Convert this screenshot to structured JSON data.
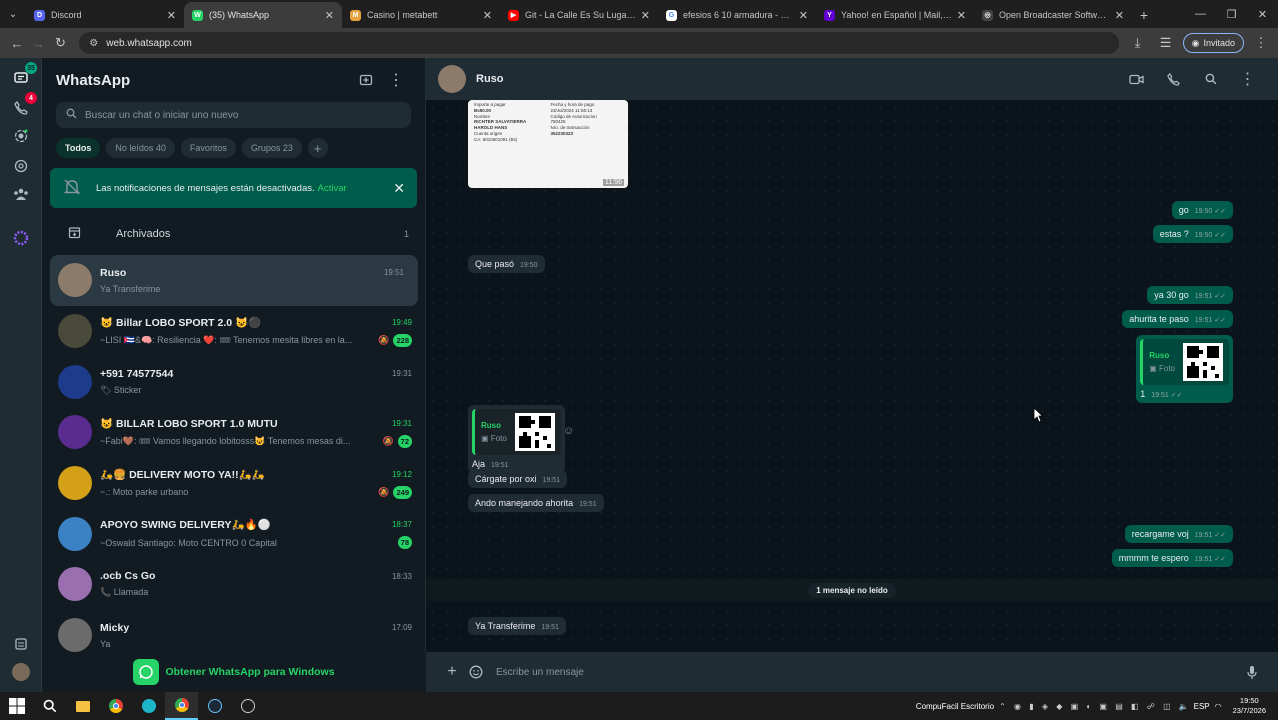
{
  "browser": {
    "tabs": [
      {
        "title": "Discord",
        "color": "#5865f2",
        "glyph": "D"
      },
      {
        "title": "(35) WhatsApp",
        "color": "#25d366",
        "glyph": "W",
        "active": true
      },
      {
        "title": "Casino | metabett",
        "color": "#e8a33d",
        "glyph": "M"
      },
      {
        "title": "Git - La Calle Es Su Lugar (A",
        "color": "#ff0000",
        "glyph": "▶"
      },
      {
        "title": "efesios 6 10 armadura - Buscar",
        "color": "#ffffff",
        "glyph": "G"
      },
      {
        "title": "Yahoo! en Español | Mail, Clima",
        "color": "#6001d2",
        "glyph": "Y"
      },
      {
        "title": "Open Broadcaster Software | O",
        "color": "#444444",
        "glyph": "◎"
      }
    ],
    "url": "web.whatsapp.com",
    "profile_label": "Invitado"
  },
  "rail": {
    "chats_badge": "35",
    "calls_badge": "4"
  },
  "sidebar": {
    "title": "WhatsApp",
    "search_placeholder": "Buscar un chat o iniciar uno nuevo",
    "filters": [
      "Todos",
      "No leídos 40",
      "Favoritos",
      "Grupos 23"
    ],
    "notification_text": "Las notificaciones de mensajes están desactivadas.",
    "notification_action": "Activar",
    "archived_label": "Archivados",
    "archived_count": "1",
    "get_windows": "Obtener WhatsApp para Windows"
  },
  "chats": [
    {
      "name": "Ruso",
      "message": "Ya Transferime",
      "time": "19:51",
      "unread": "",
      "muted": false,
      "selected": true,
      "avatar_color": "#8c7b6a"
    },
    {
      "name": "😺 Billar LOBO SPORT 2.0 😺⚫",
      "message": "~LISI 🇨🇺&🧠: Resiliencia ❤️: 🎟 Tenemos mesita libres en la...",
      "time": "19:49",
      "unread": "228",
      "muted": true,
      "selected": false,
      "avatar_color": "#4a4a3a"
    },
    {
      "name": "+591 74577544",
      "message": "🏷 Sticker",
      "time": "19:31",
      "unread": "",
      "muted": false,
      "selected": false,
      "avatar_color": "#1e3a8a"
    },
    {
      "name": "😺 BILLAR LOBO SPORT 1.0 MUTU",
      "message": "~Fabi🤎: 🎟 Vamos llegando lobitosss😺 Tenemos mesas di...",
      "time": "19:31",
      "unread": "72",
      "muted": true,
      "selected": false,
      "avatar_color": "#5b2c8f"
    },
    {
      "name": "🛵🍔 DELIVERY MOTO YA!!🛵🛵",
      "message": "~.: Moto parke urbano",
      "time": "19:12",
      "unread": "249",
      "muted": true,
      "selected": false,
      "avatar_color": "#d4a017"
    },
    {
      "name": "APOYO SWING DELIVERY🛵🔥⚪",
      "message": "~Oswald Santiago: Moto CENTRO 0 Capital",
      "time": "18:37",
      "unread": "78",
      "muted": false,
      "selected": false,
      "avatar_color": "#3b82c4"
    },
    {
      "name": ".ocb Cs Go",
      "message": "📞 Llamada",
      "time": "18:33",
      "unread": "",
      "muted": false,
      "selected": false,
      "avatar_color": "#9a6fb0"
    },
    {
      "name": "Micky",
      "message": "Ya",
      "time": "17:09",
      "unread": "",
      "muted": false,
      "selected": false,
      "avatar_color": "#6b6b6b"
    }
  ],
  "conversation": {
    "contact_name": "Ruso",
    "composer_placeholder": "Escribe un mensaje",
    "receipt": {
      "lines": [
        "Importe a pagar",
        "Bs50.00",
        "Nombre",
        "RICHTER SALVATIERRA",
        "HAROLD HANS",
        "Cuenta origen",
        "CA: 6010501091 (Bs)",
        "Fecha y hora de pago",
        "23/Jul/2024 11:56:13",
        "Código de Autorizacion",
        "780425",
        "Nro. de transacción",
        "352230323"
      ],
      "time": "11:56"
    },
    "messages": [
      {
        "text": "go",
        "time": "19:50",
        "dir": "out"
      },
      {
        "text": "estas ?",
        "time": "19:50",
        "dir": "out"
      },
      {
        "text": "Que pasó",
        "time": "19:50",
        "dir": "in"
      },
      {
        "text": "ya 30 go",
        "time": "19:51",
        "dir": "out"
      },
      {
        "text": "ahurita te paso",
        "time": "19:51",
        "dir": "out"
      },
      {
        "text": "1",
        "time": "19:51",
        "dir": "out",
        "quote_name": "Ruso",
        "quote_label": "Foto"
      },
      {
        "text": "Aja",
        "time": "19:51",
        "dir": "in",
        "quote_name": "Ruso",
        "quote_label": "Foto"
      },
      {
        "text": "Cárgate por oxi",
        "time": "19:51",
        "dir": "in"
      },
      {
        "text": "Ando manejando ahorita",
        "time": "19:51",
        "dir": "in"
      },
      {
        "text": "recargame voj",
        "time": "19:51",
        "dir": "out"
      },
      {
        "text": "mmmm  te espero",
        "time": "19:51",
        "dir": "out"
      },
      {
        "text": "Ya Transferime",
        "time": "19:51",
        "dir": "in"
      }
    ],
    "unread_divider": "1 mensaje no leído"
  },
  "taskbar": {
    "app_label": "CompuFacil Escritorio",
    "lang": "ESP",
    "time": "19:50",
    "date": "23/7/2026"
  }
}
